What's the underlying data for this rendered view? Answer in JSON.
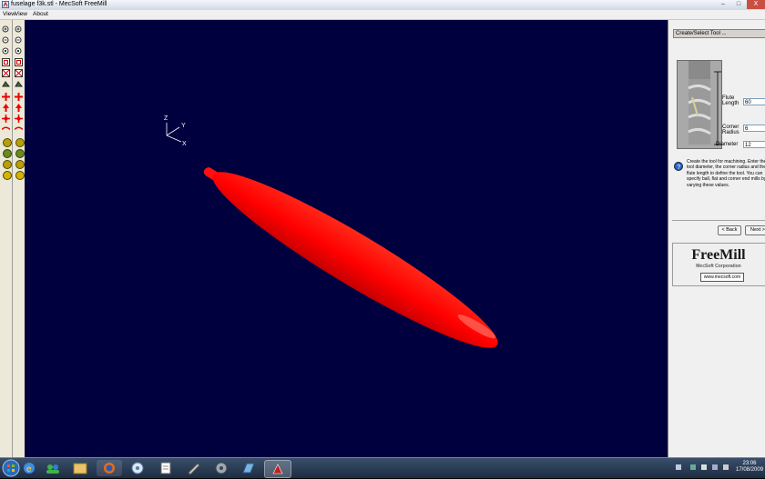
{
  "window": {
    "title": "fuselage f3k.stl - MecSoft FreeMill",
    "minimize": "–",
    "maximize": "□",
    "close": "X"
  },
  "menu": {
    "items": [
      "View",
      "View",
      "About"
    ]
  },
  "viewport": {
    "background": "#00003f",
    "model_color": "#ff0000",
    "axis_labels": {
      "z": "Z",
      "y": "Y",
      "x": "X"
    }
  },
  "panel": {
    "header": "Create/Select Tool ...",
    "flute_length_label": "Flute Length",
    "flute_length_value": "60",
    "corner_radius_label": "Corner Radius",
    "corner_radius_value": "6",
    "diameter_label": "Diameter",
    "diameter_value": "12",
    "help_text": "Create the tool for machining. Enter the tool diameter, the corner radius and the flute length to define the tool. You can specify ball, flat and corner end mills by varying these values.",
    "back_button": "< Back",
    "next_button": "Next >",
    "logo_title": "FreeMill",
    "logo_subtitle": "MecSoft Corporation",
    "logo_url": "www.mecsoft.com"
  },
  "taskbar": {
    "time": "23:06",
    "date": "17/08/2009"
  }
}
